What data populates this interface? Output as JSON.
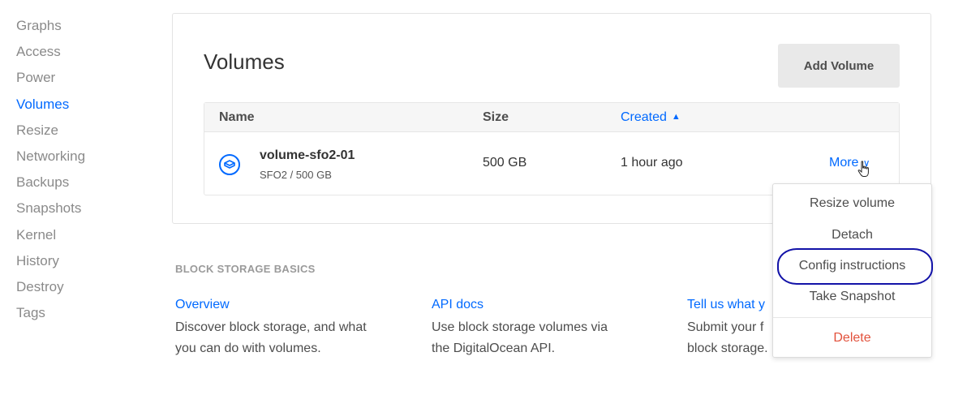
{
  "sidebar": {
    "items": [
      {
        "label": "Graphs"
      },
      {
        "label": "Access"
      },
      {
        "label": "Power"
      },
      {
        "label": "Volumes",
        "active": true
      },
      {
        "label": "Resize"
      },
      {
        "label": "Networking"
      },
      {
        "label": "Backups"
      },
      {
        "label": "Snapshots"
      },
      {
        "label": "Kernel"
      },
      {
        "label": "History"
      },
      {
        "label": "Destroy"
      },
      {
        "label": "Tags"
      }
    ]
  },
  "volumes_card": {
    "title": "Volumes",
    "add_button": "Add Volume",
    "columns": {
      "name": "Name",
      "size": "Size",
      "created": "Created"
    },
    "rows": [
      {
        "name": "volume-sfo2-01",
        "subtitle": "SFO2 / 500 GB",
        "size": "500 GB",
        "created": "1 hour ago",
        "more": "More"
      }
    ]
  },
  "more_menu": {
    "items": [
      "Resize volume",
      "Detach",
      "Config instructions",
      "Take Snapshot"
    ],
    "delete": "Delete"
  },
  "basics": {
    "heading": "BLOCK STORAGE BASICS",
    "columns": [
      {
        "link": "Overview",
        "text": "Discover block storage, and what you can do with volumes."
      },
      {
        "link": "API docs",
        "text": "Use block storage volumes via the DigitalOcean API."
      },
      {
        "link": "Tell us what y",
        "text": "Submit your f block storage."
      }
    ]
  },
  "colors": {
    "accent": "#0069ff",
    "delete": "#e2513b",
    "annotation": "#1313a8"
  }
}
